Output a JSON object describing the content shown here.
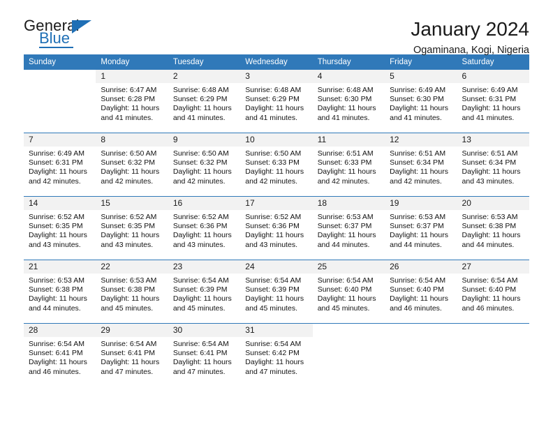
{
  "logo": {
    "primary_text": "General",
    "secondary_text": "Blue",
    "accent_color": "#1f6fb5",
    "triangle_icon": "triangle-icon"
  },
  "header": {
    "title": "January 2024",
    "subtitle": "Ogaminana, Kogi, Nigeria"
  },
  "theme": {
    "header_row_bg": "#3079b9",
    "header_row_text": "#ffffff",
    "daynum_bg": "#f2f2f2",
    "row_divider": "#3079b9",
    "body_text": "#111111"
  },
  "calendar": {
    "weekday_headers": [
      "Sunday",
      "Monday",
      "Tuesday",
      "Wednesday",
      "Thursday",
      "Friday",
      "Saturday"
    ],
    "labels": {
      "sunrise": "Sunrise:",
      "sunset": "Sunset:",
      "daylight": "Daylight:"
    },
    "weeks": [
      [
        {
          "day": "",
          "sunrise": "",
          "sunset": "",
          "daylight_line1": "",
          "daylight_line2": "",
          "empty": true
        },
        {
          "day": "1",
          "sunrise": "Sunrise: 6:47 AM",
          "sunset": "Sunset: 6:28 PM",
          "daylight_line1": "Daylight: 11 hours",
          "daylight_line2": "and 41 minutes.",
          "empty": false
        },
        {
          "day": "2",
          "sunrise": "Sunrise: 6:48 AM",
          "sunset": "Sunset: 6:29 PM",
          "daylight_line1": "Daylight: 11 hours",
          "daylight_line2": "and 41 minutes.",
          "empty": false
        },
        {
          "day": "3",
          "sunrise": "Sunrise: 6:48 AM",
          "sunset": "Sunset: 6:29 PM",
          "daylight_line1": "Daylight: 11 hours",
          "daylight_line2": "and 41 minutes.",
          "empty": false
        },
        {
          "day": "4",
          "sunrise": "Sunrise: 6:48 AM",
          "sunset": "Sunset: 6:30 PM",
          "daylight_line1": "Daylight: 11 hours",
          "daylight_line2": "and 41 minutes.",
          "empty": false
        },
        {
          "day": "5",
          "sunrise": "Sunrise: 6:49 AM",
          "sunset": "Sunset: 6:30 PM",
          "daylight_line1": "Daylight: 11 hours",
          "daylight_line2": "and 41 minutes.",
          "empty": false
        },
        {
          "day": "6",
          "sunrise": "Sunrise: 6:49 AM",
          "sunset": "Sunset: 6:31 PM",
          "daylight_line1": "Daylight: 11 hours",
          "daylight_line2": "and 41 minutes.",
          "empty": false
        }
      ],
      [
        {
          "day": "7",
          "sunrise": "Sunrise: 6:49 AM",
          "sunset": "Sunset: 6:31 PM",
          "daylight_line1": "Daylight: 11 hours",
          "daylight_line2": "and 42 minutes.",
          "empty": false
        },
        {
          "day": "8",
          "sunrise": "Sunrise: 6:50 AM",
          "sunset": "Sunset: 6:32 PM",
          "daylight_line1": "Daylight: 11 hours",
          "daylight_line2": "and 42 minutes.",
          "empty": false
        },
        {
          "day": "9",
          "sunrise": "Sunrise: 6:50 AM",
          "sunset": "Sunset: 6:32 PM",
          "daylight_line1": "Daylight: 11 hours",
          "daylight_line2": "and 42 minutes.",
          "empty": false
        },
        {
          "day": "10",
          "sunrise": "Sunrise: 6:50 AM",
          "sunset": "Sunset: 6:33 PM",
          "daylight_line1": "Daylight: 11 hours",
          "daylight_line2": "and 42 minutes.",
          "empty": false
        },
        {
          "day": "11",
          "sunrise": "Sunrise: 6:51 AM",
          "sunset": "Sunset: 6:33 PM",
          "daylight_line1": "Daylight: 11 hours",
          "daylight_line2": "and 42 minutes.",
          "empty": false
        },
        {
          "day": "12",
          "sunrise": "Sunrise: 6:51 AM",
          "sunset": "Sunset: 6:34 PM",
          "daylight_line1": "Daylight: 11 hours",
          "daylight_line2": "and 42 minutes.",
          "empty": false
        },
        {
          "day": "13",
          "sunrise": "Sunrise: 6:51 AM",
          "sunset": "Sunset: 6:34 PM",
          "daylight_line1": "Daylight: 11 hours",
          "daylight_line2": "and 43 minutes.",
          "empty": false
        }
      ],
      [
        {
          "day": "14",
          "sunrise": "Sunrise: 6:52 AM",
          "sunset": "Sunset: 6:35 PM",
          "daylight_line1": "Daylight: 11 hours",
          "daylight_line2": "and 43 minutes.",
          "empty": false
        },
        {
          "day": "15",
          "sunrise": "Sunrise: 6:52 AM",
          "sunset": "Sunset: 6:35 PM",
          "daylight_line1": "Daylight: 11 hours",
          "daylight_line2": "and 43 minutes.",
          "empty": false
        },
        {
          "day": "16",
          "sunrise": "Sunrise: 6:52 AM",
          "sunset": "Sunset: 6:36 PM",
          "daylight_line1": "Daylight: 11 hours",
          "daylight_line2": "and 43 minutes.",
          "empty": false
        },
        {
          "day": "17",
          "sunrise": "Sunrise: 6:52 AM",
          "sunset": "Sunset: 6:36 PM",
          "daylight_line1": "Daylight: 11 hours",
          "daylight_line2": "and 43 minutes.",
          "empty": false
        },
        {
          "day": "18",
          "sunrise": "Sunrise: 6:53 AM",
          "sunset": "Sunset: 6:37 PM",
          "daylight_line1": "Daylight: 11 hours",
          "daylight_line2": "and 44 minutes.",
          "empty": false
        },
        {
          "day": "19",
          "sunrise": "Sunrise: 6:53 AM",
          "sunset": "Sunset: 6:37 PM",
          "daylight_line1": "Daylight: 11 hours",
          "daylight_line2": "and 44 minutes.",
          "empty": false
        },
        {
          "day": "20",
          "sunrise": "Sunrise: 6:53 AM",
          "sunset": "Sunset: 6:38 PM",
          "daylight_line1": "Daylight: 11 hours",
          "daylight_line2": "and 44 minutes.",
          "empty": false
        }
      ],
      [
        {
          "day": "21",
          "sunrise": "Sunrise: 6:53 AM",
          "sunset": "Sunset: 6:38 PM",
          "daylight_line1": "Daylight: 11 hours",
          "daylight_line2": "and 44 minutes.",
          "empty": false
        },
        {
          "day": "22",
          "sunrise": "Sunrise: 6:53 AM",
          "sunset": "Sunset: 6:38 PM",
          "daylight_line1": "Daylight: 11 hours",
          "daylight_line2": "and 45 minutes.",
          "empty": false
        },
        {
          "day": "23",
          "sunrise": "Sunrise: 6:54 AM",
          "sunset": "Sunset: 6:39 PM",
          "daylight_line1": "Daylight: 11 hours",
          "daylight_line2": "and 45 minutes.",
          "empty": false
        },
        {
          "day": "24",
          "sunrise": "Sunrise: 6:54 AM",
          "sunset": "Sunset: 6:39 PM",
          "daylight_line1": "Daylight: 11 hours",
          "daylight_line2": "and 45 minutes.",
          "empty": false
        },
        {
          "day": "25",
          "sunrise": "Sunrise: 6:54 AM",
          "sunset": "Sunset: 6:40 PM",
          "daylight_line1": "Daylight: 11 hours",
          "daylight_line2": "and 45 minutes.",
          "empty": false
        },
        {
          "day": "26",
          "sunrise": "Sunrise: 6:54 AM",
          "sunset": "Sunset: 6:40 PM",
          "daylight_line1": "Daylight: 11 hours",
          "daylight_line2": "and 46 minutes.",
          "empty": false
        },
        {
          "day": "27",
          "sunrise": "Sunrise: 6:54 AM",
          "sunset": "Sunset: 6:40 PM",
          "daylight_line1": "Daylight: 11 hours",
          "daylight_line2": "and 46 minutes.",
          "empty": false
        }
      ],
      [
        {
          "day": "28",
          "sunrise": "Sunrise: 6:54 AM",
          "sunset": "Sunset: 6:41 PM",
          "daylight_line1": "Daylight: 11 hours",
          "daylight_line2": "and 46 minutes.",
          "empty": false
        },
        {
          "day": "29",
          "sunrise": "Sunrise: 6:54 AM",
          "sunset": "Sunset: 6:41 PM",
          "daylight_line1": "Daylight: 11 hours",
          "daylight_line2": "and 47 minutes.",
          "empty": false
        },
        {
          "day": "30",
          "sunrise": "Sunrise: 6:54 AM",
          "sunset": "Sunset: 6:41 PM",
          "daylight_line1": "Daylight: 11 hours",
          "daylight_line2": "and 47 minutes.",
          "empty": false
        },
        {
          "day": "31",
          "sunrise": "Sunrise: 6:54 AM",
          "sunset": "Sunset: 6:42 PM",
          "daylight_line1": "Daylight: 11 hours",
          "daylight_line2": "and 47 minutes.",
          "empty": false
        },
        {
          "day": "",
          "sunrise": "",
          "sunset": "",
          "daylight_line1": "",
          "daylight_line2": "",
          "empty": true
        },
        {
          "day": "",
          "sunrise": "",
          "sunset": "",
          "daylight_line1": "",
          "daylight_line2": "",
          "empty": true
        },
        {
          "day": "",
          "sunrise": "",
          "sunset": "",
          "daylight_line1": "",
          "daylight_line2": "",
          "empty": true
        }
      ]
    ]
  }
}
